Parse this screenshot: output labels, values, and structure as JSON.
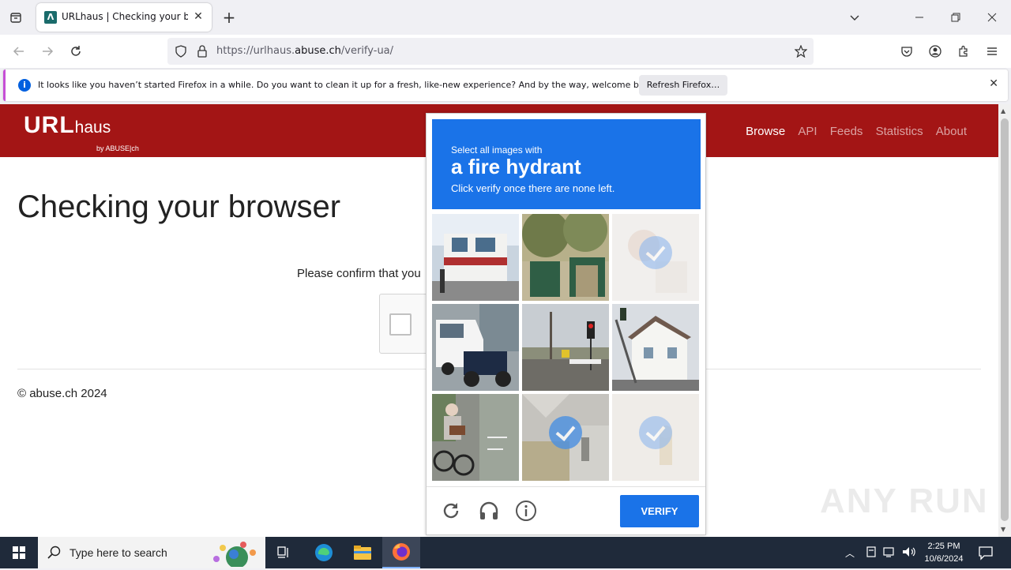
{
  "browser": {
    "tab_title": "URLhaus | Checking your browser",
    "url_prefix": "https://urlhaus.",
    "url_domain": "abuse.ch",
    "url_path": "/verify-ua/"
  },
  "notification": {
    "message": "It looks like you haven’t started Firefox in a while. Do you want to clean it up for a fresh, like-new experience? And by the way, welcome back!",
    "button": "Refresh Firefox…"
  },
  "site": {
    "logo_main": "URL",
    "logo_sub": "haus",
    "logo_by": "by ABUSE|ch",
    "nav": [
      "Browse",
      "API",
      "Feeds",
      "Statistics",
      "About"
    ],
    "heading": "Checking your browser",
    "confirm_text": "Please confirm that you",
    "footer": "© abuse.ch 2024"
  },
  "captcha": {
    "line1": "Select all images with",
    "line2": "a fire hydrant",
    "line3": "Click verify once there are none left.",
    "verify_label": "VERIFY",
    "tiles": [
      {
        "scene": "storefront",
        "selected": false
      },
      {
        "scene": "green-gate",
        "selected": false
      },
      {
        "scene": "faded",
        "selected": true
      },
      {
        "scene": "van-motorbike",
        "selected": false
      },
      {
        "scene": "traffic-light-street",
        "selected": false
      },
      {
        "scene": "house-traffic-light",
        "selected": false
      },
      {
        "scene": "cyclist",
        "selected": false
      },
      {
        "scene": "curb-hydrant",
        "selected": true
      },
      {
        "scene": "faded-hydrant",
        "selected": true
      }
    ]
  },
  "watermark": "ANY RUN",
  "taskbar": {
    "search_placeholder": "Type here to search",
    "time": "2:25 PM",
    "date": "10/6/2024"
  }
}
